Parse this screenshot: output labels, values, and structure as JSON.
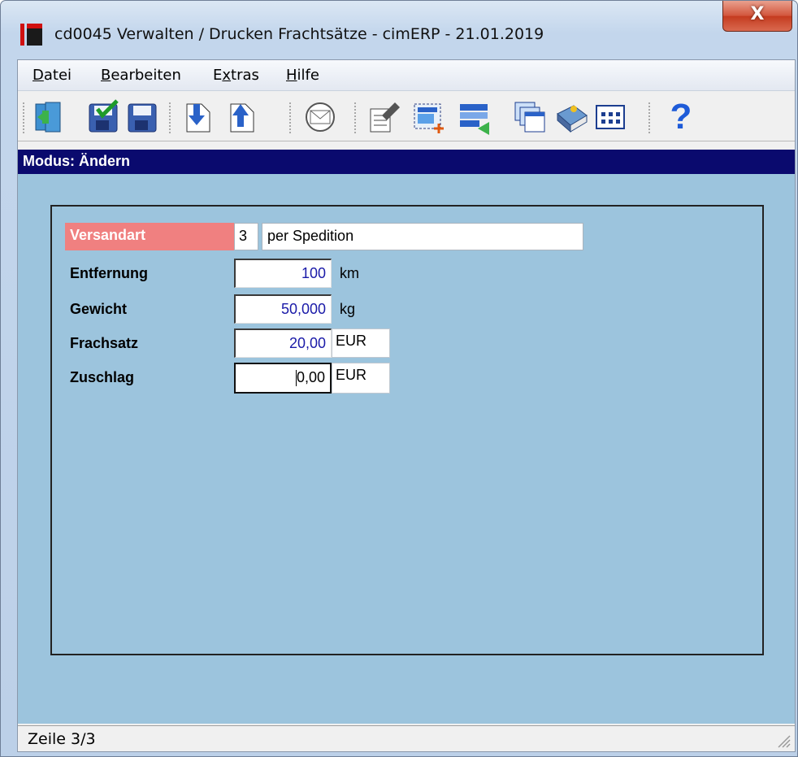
{
  "window": {
    "title": "cd0045 Verwalten / Drucken Frachtsätze - cimERP - 21.01.2019",
    "close_label": "X"
  },
  "menu": [
    {
      "label": "Datei",
      "accel": "D",
      "rest": "atei"
    },
    {
      "label": "Bearbeiten",
      "accel": "B",
      "rest": "earbeiten"
    },
    {
      "label": "Extras",
      "accel_pre": "E",
      "accel": "x",
      "rest": "tras"
    },
    {
      "label": "Hilfe",
      "accel": "H",
      "rest": "ilfe"
    }
  ],
  "toolbar": {
    "icons": [
      "exit-icon",
      "save-check-icon",
      "save-icon",
      "next-record-icon",
      "prev-record-icon",
      "mail-icon",
      "edit-text-icon",
      "new-record-icon",
      "transfer-icon",
      "windows-icon",
      "book-icon",
      "grid-icon",
      "help-icon"
    ],
    "help_label": "?"
  },
  "mode": {
    "text": "Modus: Ändern"
  },
  "form": {
    "versandart": {
      "label": "Versandart",
      "code": "3",
      "description": "per Spedition"
    },
    "entfernung": {
      "label": "Entfernung",
      "value": "100",
      "unit": "km"
    },
    "gewicht": {
      "label": "Gewicht",
      "value": "50,000",
      "unit": "kg"
    },
    "frachsatz": {
      "label": "Frachsatz",
      "value": "20,00",
      "unit": "EUR"
    },
    "zuschlag": {
      "label": "Zuschlag",
      "value": "0,00",
      "unit": "EUR"
    }
  },
  "status": {
    "text": "Zeile 3/3"
  },
  "colors": {
    "mode_bar": "#0a0a6e",
    "content_bg": "#9cc4dd",
    "required_label_bg": "#f08080",
    "number_text": "#1a1aa8"
  }
}
